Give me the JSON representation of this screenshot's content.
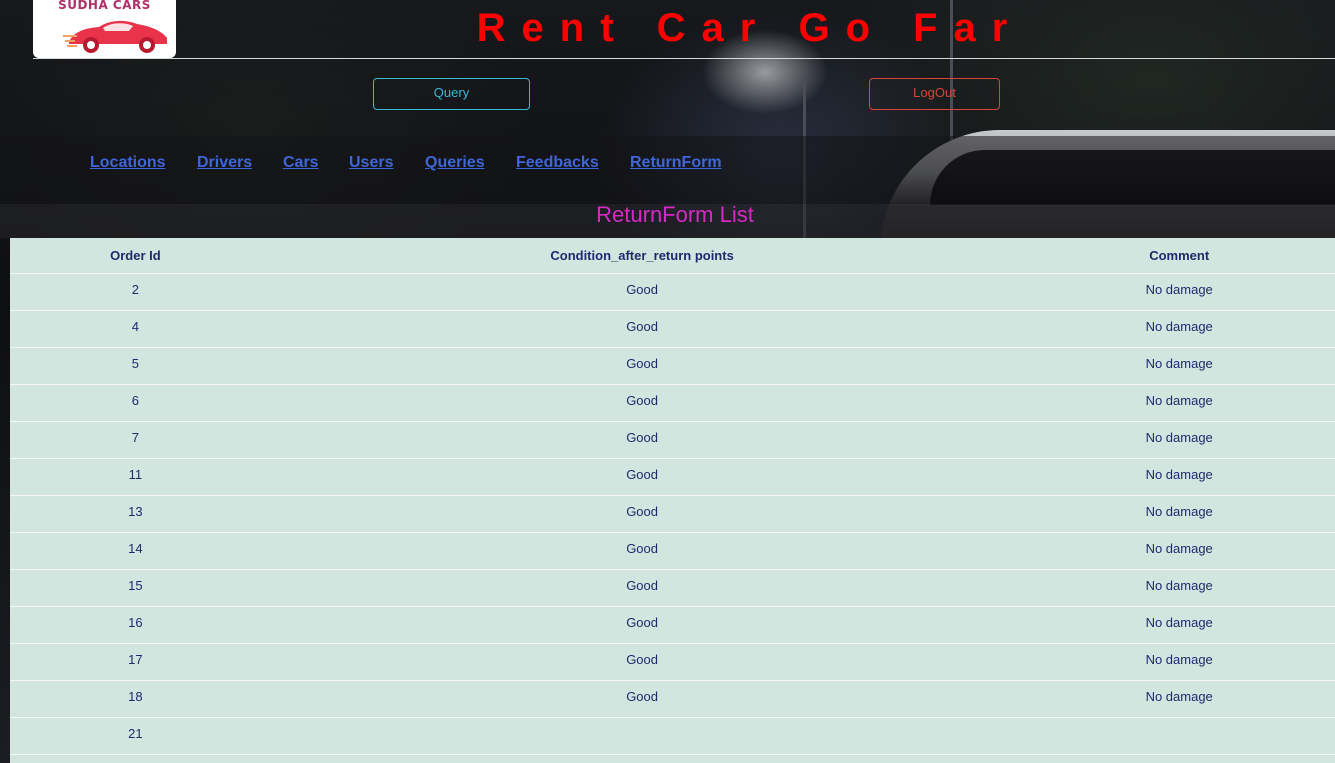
{
  "header": {
    "logo_text": "SUDHA CARS",
    "site_title": "Rent Car Go Far"
  },
  "buttons": {
    "query_label": "Query",
    "logout_label": "LogOut"
  },
  "nav": {
    "items": [
      "Locations",
      "Drivers",
      "Cars",
      "Users",
      "Queries",
      "Feedbacks",
      "ReturnForm"
    ]
  },
  "section": {
    "title": "ReturnForm List"
  },
  "table": {
    "columns": [
      "Order Id",
      "Condition_after_return points",
      "Comment"
    ],
    "rows": [
      {
        "order_id": "2",
        "condition": "Good",
        "comment": "No damage"
      },
      {
        "order_id": "4",
        "condition": "Good",
        "comment": "No damage"
      },
      {
        "order_id": "5",
        "condition": "Good",
        "comment": "No damage"
      },
      {
        "order_id": "6",
        "condition": "Good",
        "comment": "No damage"
      },
      {
        "order_id": "7",
        "condition": "Good",
        "comment": "No damage"
      },
      {
        "order_id": "11",
        "condition": "Good",
        "comment": "No damage"
      },
      {
        "order_id": "13",
        "condition": "Good",
        "comment": "No damage"
      },
      {
        "order_id": "14",
        "condition": "Good",
        "comment": "No damage"
      },
      {
        "order_id": "15",
        "condition": "Good",
        "comment": "No damage"
      },
      {
        "order_id": "16",
        "condition": "Good",
        "comment": "No damage"
      },
      {
        "order_id": "17",
        "condition": "Good",
        "comment": "No damage"
      },
      {
        "order_id": "18",
        "condition": "Good",
        "comment": "No damage"
      },
      {
        "order_id": "21",
        "condition": "",
        "comment": ""
      }
    ]
  },
  "colors": {
    "title_red": "#ff0000",
    "query_accent": "#3ab8d6",
    "logout_accent": "#d9443c",
    "nav_link": "#3f66d8",
    "section_title": "#d629c8",
    "table_bg": "#d2e6df",
    "table_text": "#1f2a6e"
  }
}
